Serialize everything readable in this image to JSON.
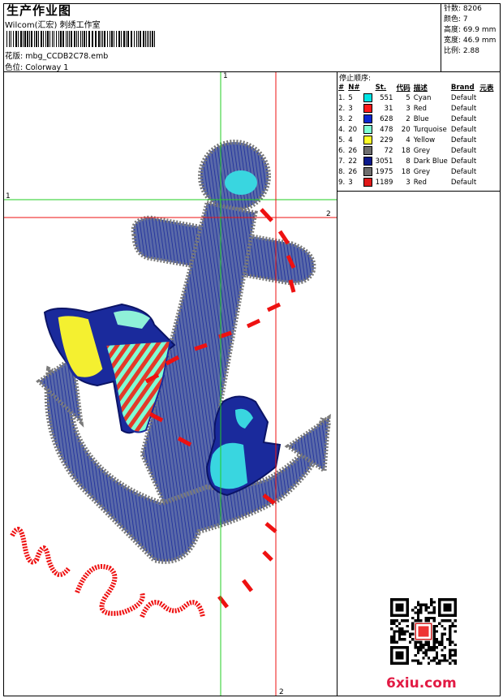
{
  "header": {
    "title": "生产作业图",
    "company": "Wilcom(汇宏) 刺绣工作室",
    "design_name_label": "花版:",
    "design_name": "mbg_CCDB2C78.emb",
    "colorway_label": "色位:",
    "colorway": "Colorway 1"
  },
  "stats": {
    "stitches_label": "针数:",
    "stitches": "8206",
    "colors_label": "颜色:",
    "colors": "7",
    "height_label": "高度:",
    "height": "69.9 mm",
    "width_label": "宽度:",
    "width": "46.9 mm",
    "ratio_label": "比例:",
    "ratio": "2.88"
  },
  "stop_sequence": {
    "title": "停止顺序:",
    "columns": [
      "#",
      "N#",
      "St.",
      "代码",
      "描述",
      "Brand",
      "元表"
    ],
    "rows": [
      {
        "num": "1.",
        "needle": "5",
        "color": "#00e5e5",
        "stitches": "551",
        "code": "5",
        "desc": "Cyan",
        "brand": "Default"
      },
      {
        "num": "2.",
        "needle": "3",
        "color": "#ff1a1a",
        "stitches": "31",
        "code": "3",
        "desc": "Red",
        "brand": "Default"
      },
      {
        "num": "3.",
        "needle": "2",
        "color": "#0a28d2",
        "stitches": "628",
        "code": "2",
        "desc": "Blue",
        "brand": "Default"
      },
      {
        "num": "4.",
        "needle": "20",
        "color": "#7fffd4",
        "stitches": "478",
        "code": "20",
        "desc": "Turquoise",
        "brand": "Default"
      },
      {
        "num": "5.",
        "needle": "4",
        "color": "#ffff2a",
        "stitches": "229",
        "code": "4",
        "desc": "Yellow",
        "brand": "Default"
      },
      {
        "num": "6.",
        "needle": "26",
        "color": "#6e6e6e",
        "stitches": "72",
        "code": "18",
        "desc": "Grey",
        "brand": "Default"
      },
      {
        "num": "7.",
        "needle": "22",
        "color": "#0b1a8c",
        "stitches": "3051",
        "code": "8",
        "desc": "Dark Blue",
        "brand": "Default"
      },
      {
        "num": "8.",
        "needle": "26",
        "color": "#6e6e6e",
        "stitches": "1975",
        "code": "18",
        "desc": "Grey",
        "brand": "Default"
      },
      {
        "num": "9.",
        "needle": "3",
        "color": "#e01818",
        "stitches": "1189",
        "code": "3",
        "desc": "Red",
        "brand": "Default"
      }
    ]
  },
  "guides": {
    "green_x_label": "1",
    "green_y_label": "1",
    "red_x_label": "2",
    "red_y_label": "2",
    "green_color": "#22cc22",
    "red_color": "#ee1111"
  },
  "footer": {
    "brand": "6xiu.com",
    "brand_color": "#e21b44"
  }
}
